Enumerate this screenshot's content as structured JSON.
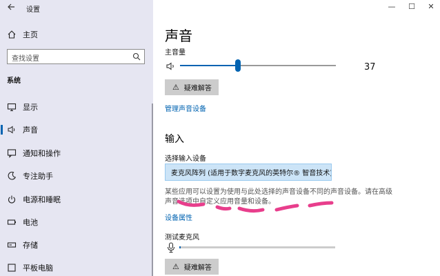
{
  "window": {
    "title": "设置",
    "controls": [
      "—",
      "☐",
      "✕"
    ]
  },
  "sidebar": {
    "home_label": "主页",
    "search_placeholder": "查找设置",
    "section": "系统",
    "items": [
      {
        "label": "显示",
        "icon": "monitor-icon",
        "active": false
      },
      {
        "label": "声音",
        "icon": "speaker-icon",
        "active": true
      },
      {
        "label": "通知和操作",
        "icon": "notification-icon",
        "active": false
      },
      {
        "label": "专注助手",
        "icon": "moon-icon",
        "active": false
      },
      {
        "label": "电源和睡眠",
        "icon": "power-icon",
        "active": false
      },
      {
        "label": "电池",
        "icon": "battery-icon",
        "active": false
      },
      {
        "label": "存储",
        "icon": "storage-icon",
        "active": false
      },
      {
        "label": "平板电脑",
        "icon": "tablet-icon",
        "active": false
      }
    ]
  },
  "main": {
    "title": "声音",
    "master_volume_label": "主音量",
    "volume": 37,
    "volume_text": "37",
    "troubleshoot_label": "疑难解答",
    "manage_devices_link": "管理声音设备",
    "input_section": "输入",
    "choose_input_label": "选择输入设备",
    "input_device": "麦克风阵列 (适用于数字麦克风的英特尔® 智音技术)",
    "description": "某些应用可以设置为使用与此处选择的声音设备不同的声音设备。请在高级声音选项中自定义应用音量和设备。",
    "device_properties_link": "设备属性",
    "test_mic_label": "测试麦克风",
    "mic_level": 0.01,
    "troubleshoot_label_2": "疑难解答"
  },
  "colors": {
    "accent": "#0063b1",
    "sidebar_bg": "#e6e6f2",
    "annotation": "#e83e8c"
  }
}
